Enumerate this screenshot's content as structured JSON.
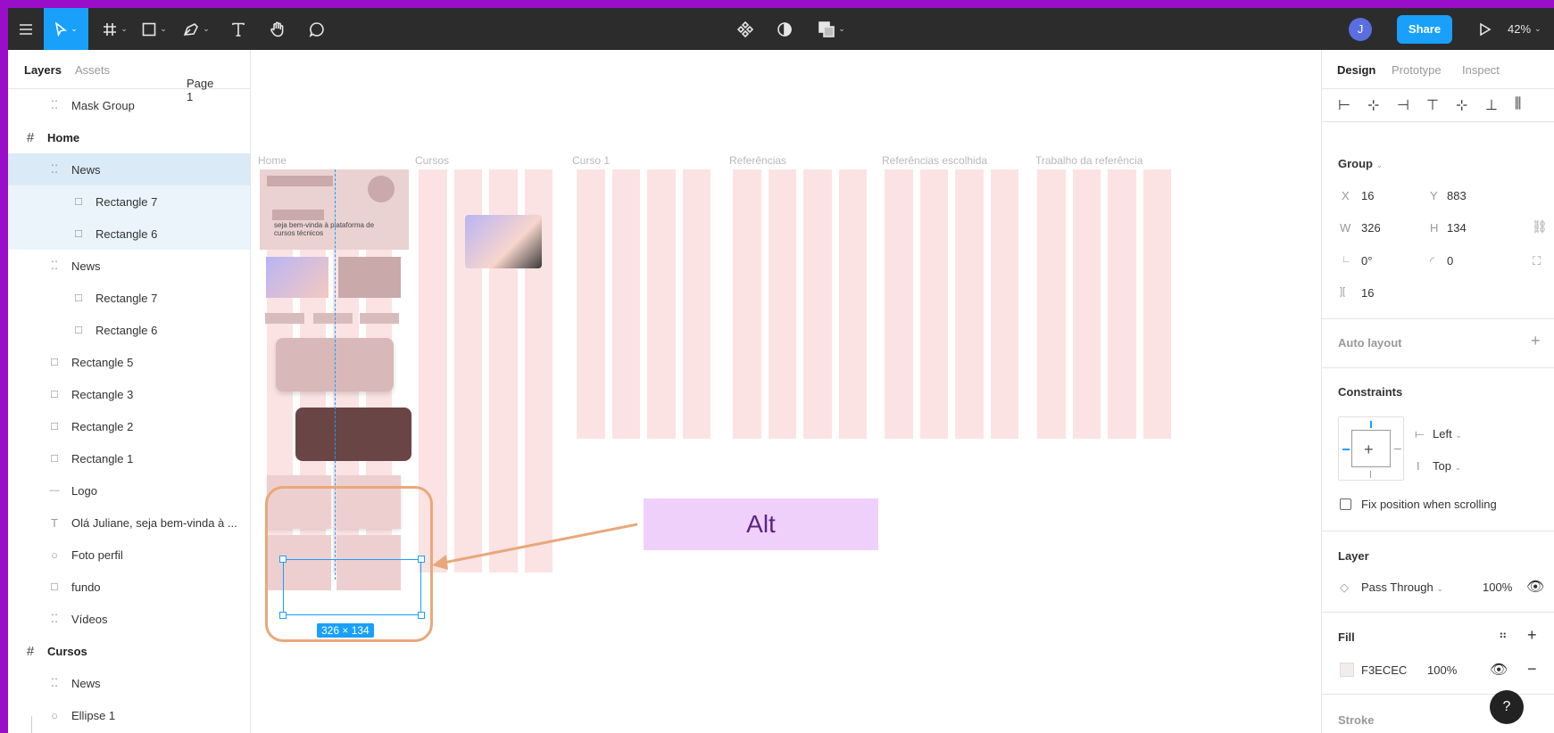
{
  "toolbar": {
    "icons": [
      "menu-icon",
      "move-tool-icon",
      "frame-tool-icon",
      "shape-tool-icon",
      "pen-tool-icon",
      "text-tool-icon",
      "hand-tool-icon",
      "comment-tool-icon",
      "components-icon",
      "mask-icon",
      "boolean-icon",
      "play-icon"
    ],
    "avatar": "J",
    "share_label": "Share",
    "zoom": "42%"
  },
  "left_panel": {
    "tabs": {
      "layers": "Layers",
      "assets": "Assets"
    },
    "page": "Page 1",
    "layers": [
      {
        "label": "Mask Group",
        "icon": "group-icon"
      },
      {
        "label": "Home",
        "icon": "frame-icon"
      },
      {
        "label": "News",
        "icon": "group-icon"
      },
      {
        "label": "Rectangle 7",
        "icon": "rectangle-icon"
      },
      {
        "label": "Rectangle 6",
        "icon": "rectangle-icon"
      },
      {
        "label": "News",
        "icon": "group-icon"
      },
      {
        "label": "Rectangle 7",
        "icon": "rectangle-icon"
      },
      {
        "label": "Rectangle 6",
        "icon": "rectangle-icon"
      },
      {
        "label": "Rectangle 5",
        "icon": "rectangle-icon"
      },
      {
        "label": "Rectangle 3",
        "icon": "rectangle-icon"
      },
      {
        "label": "Rectangle 2",
        "icon": "rectangle-icon"
      },
      {
        "label": "Rectangle 1",
        "icon": "rectangle-icon"
      },
      {
        "label": "Logo",
        "icon": "line-icon"
      },
      {
        "label": "Olá Juliane, seja bem-vinda à ...",
        "icon": "text-icon"
      },
      {
        "label": "Foto perfil",
        "icon": "ellipse-icon"
      },
      {
        "label": "fundo",
        "icon": "rectangle-icon"
      },
      {
        "label": "Vídeos",
        "icon": "group-icon"
      },
      {
        "label": "Cursos",
        "icon": "frame-icon"
      },
      {
        "label": "News",
        "icon": "group-icon"
      },
      {
        "label": "Ellipse 1",
        "icon": "ellipse-icon"
      }
    ]
  },
  "canvas": {
    "frames": [
      "Home",
      "Cursos",
      "Curso 1",
      "Referências",
      "Referências escolhida",
      "Trabalho da referência"
    ],
    "home_text": "seja bem-vinda à plataforma de cursos técnicos",
    "selection_size": "326 × 134",
    "annotation": "Alt",
    "annotation_color": "#efd0fb",
    "annotation_text_color": "#5b2483",
    "arrow_color": "#e8a87c"
  },
  "right_panel": {
    "tabs": {
      "design": "Design",
      "prototype": "Prototype",
      "inspect": "Inspect"
    },
    "group": {
      "title": "Group",
      "x_label": "X",
      "x": "16",
      "y_label": "Y",
      "y": "883",
      "w_label": "W",
      "w": "326",
      "h_label": "H",
      "h": "134",
      "rotation": "0°",
      "radius": "0",
      "spacing": "16"
    },
    "auto_layout": "Auto layout",
    "constraints": {
      "title": "Constraints",
      "horizontal": "Left",
      "vertical": "Top",
      "fix_label": "Fix position when scrolling"
    },
    "layer": {
      "title": "Layer",
      "blend": "Pass Through",
      "opacity": "100%"
    },
    "fill": {
      "title": "Fill",
      "hex": "F3ECEC",
      "opacity": "100%",
      "color": "#F3ECEC"
    },
    "stroke": {
      "title": "Stroke"
    },
    "help": "?"
  },
  "colors": {
    "accent": "#18a0fb",
    "toolbar_bg": "#2c2c2c",
    "frame_col": "#fce3e3"
  }
}
